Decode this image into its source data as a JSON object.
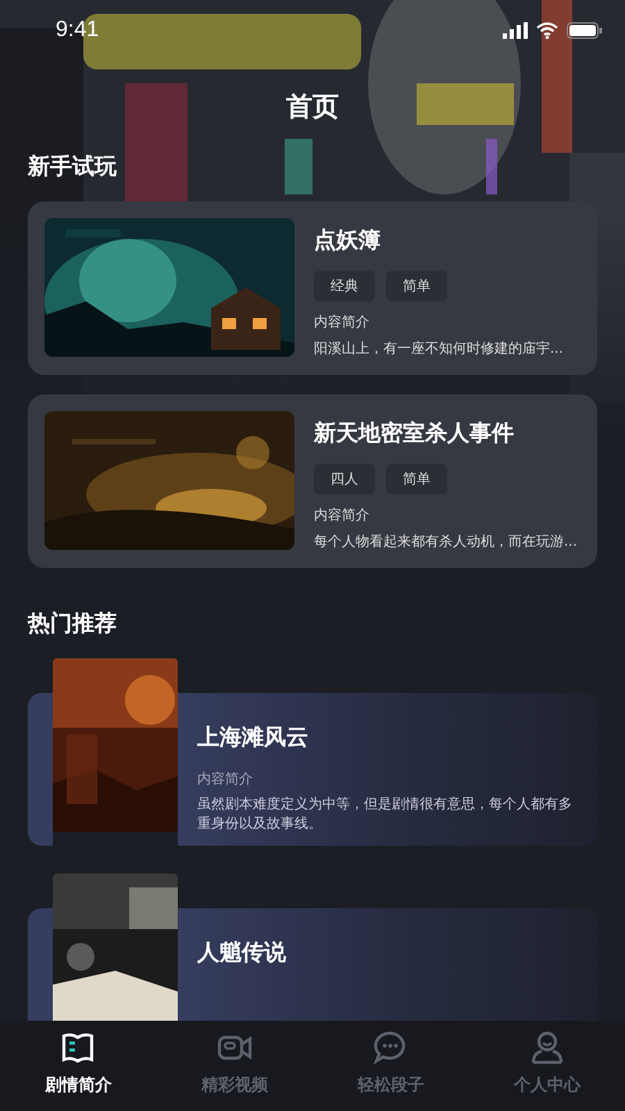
{
  "status_bar": {
    "time": "9:41"
  },
  "header": {
    "title": "首页"
  },
  "trial": {
    "heading": "新手试玩",
    "cards": [
      {
        "title": "点妖簿",
        "tags": [
          "经典",
          "简单"
        ],
        "intro_label": "内容简介",
        "intro": "阳溪山上，有一座不知何时修建的庙宇..."
      },
      {
        "title": "新天地密室杀人事件",
        "tags": [
          "四人",
          "简单"
        ],
        "intro_label": "内容简介",
        "intro": "每个人物看起来都有杀人动机，而在玩游..."
      }
    ]
  },
  "hot": {
    "heading": "热门推荐",
    "cards": [
      {
        "title": "上海滩风云",
        "intro_label": "内容简介",
        "intro": "虽然剧本难度定义为中等，但是剧情很有意思，每个人都有多重身份以及故事线。"
      },
      {
        "title": "人魈传说"
      }
    ]
  },
  "tab_bar": [
    {
      "label": "剧情简介",
      "selected": true
    },
    {
      "label": "精彩视频",
      "selected": false
    },
    {
      "label": "轻松段子",
      "selected": false
    },
    {
      "label": "个人中心",
      "selected": false
    }
  ]
}
